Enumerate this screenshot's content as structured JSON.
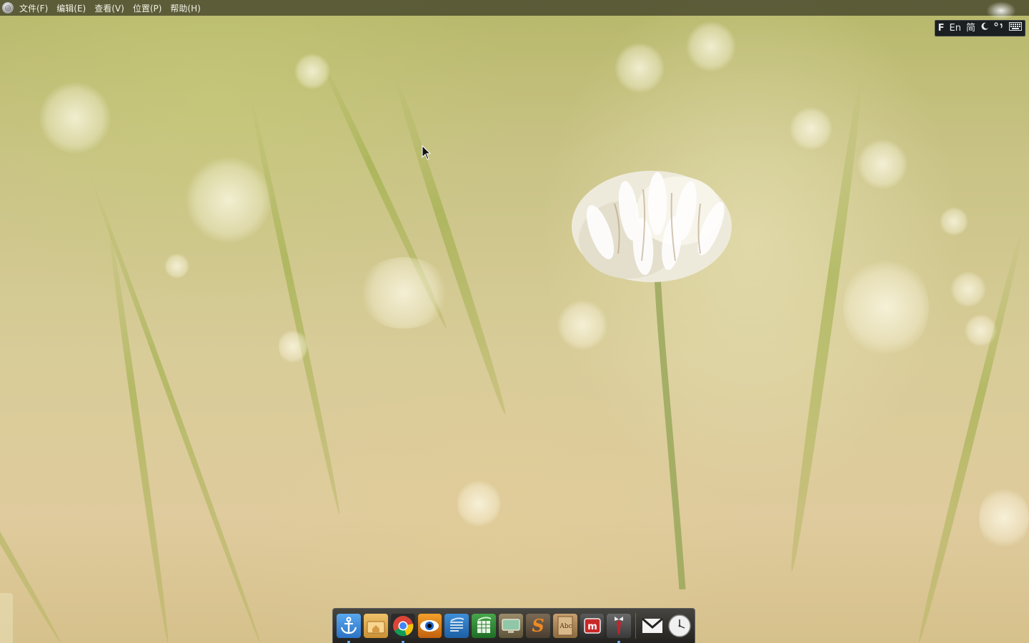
{
  "menubar": {
    "logo_icon": "ubuntu-circle-icon",
    "items": [
      {
        "label": "文件(F)"
      },
      {
        "label": "编辑(E)"
      },
      {
        "label": "查看(V)"
      },
      {
        "label": "位置(P)"
      },
      {
        "label": "帮助(H)"
      }
    ]
  },
  "ime": {
    "logo": "F",
    "lang": "En",
    "charset": "简",
    "moon_icon": "moon-icon",
    "punct_icon": "punctuation-icon",
    "keyboard_icon": "keyboard-icon"
  },
  "dock": {
    "icons": [
      {
        "name": "anchor-launcher-icon",
        "running": true
      },
      {
        "name": "home-folder-icon",
        "running": false
      },
      {
        "name": "chrome-browser-icon",
        "running": true
      },
      {
        "name": "eye-viewer-icon",
        "running": false
      },
      {
        "name": "writer-document-icon",
        "running": false
      },
      {
        "name": "spreadsheet-icon",
        "running": false
      },
      {
        "name": "presentation-icon",
        "running": false
      },
      {
        "name": "s-app-icon",
        "running": false
      },
      {
        "name": "dictionary-icon",
        "running": false
      },
      {
        "name": "m-app-icon",
        "running": false
      },
      {
        "name": "tie-app-icon",
        "running": true
      },
      {
        "name": "mail-icon",
        "running": false
      },
      {
        "name": "clock-icon",
        "running": false
      }
    ],
    "dictionary_label": "Abc",
    "m_label": "m",
    "s_label": "S"
  }
}
